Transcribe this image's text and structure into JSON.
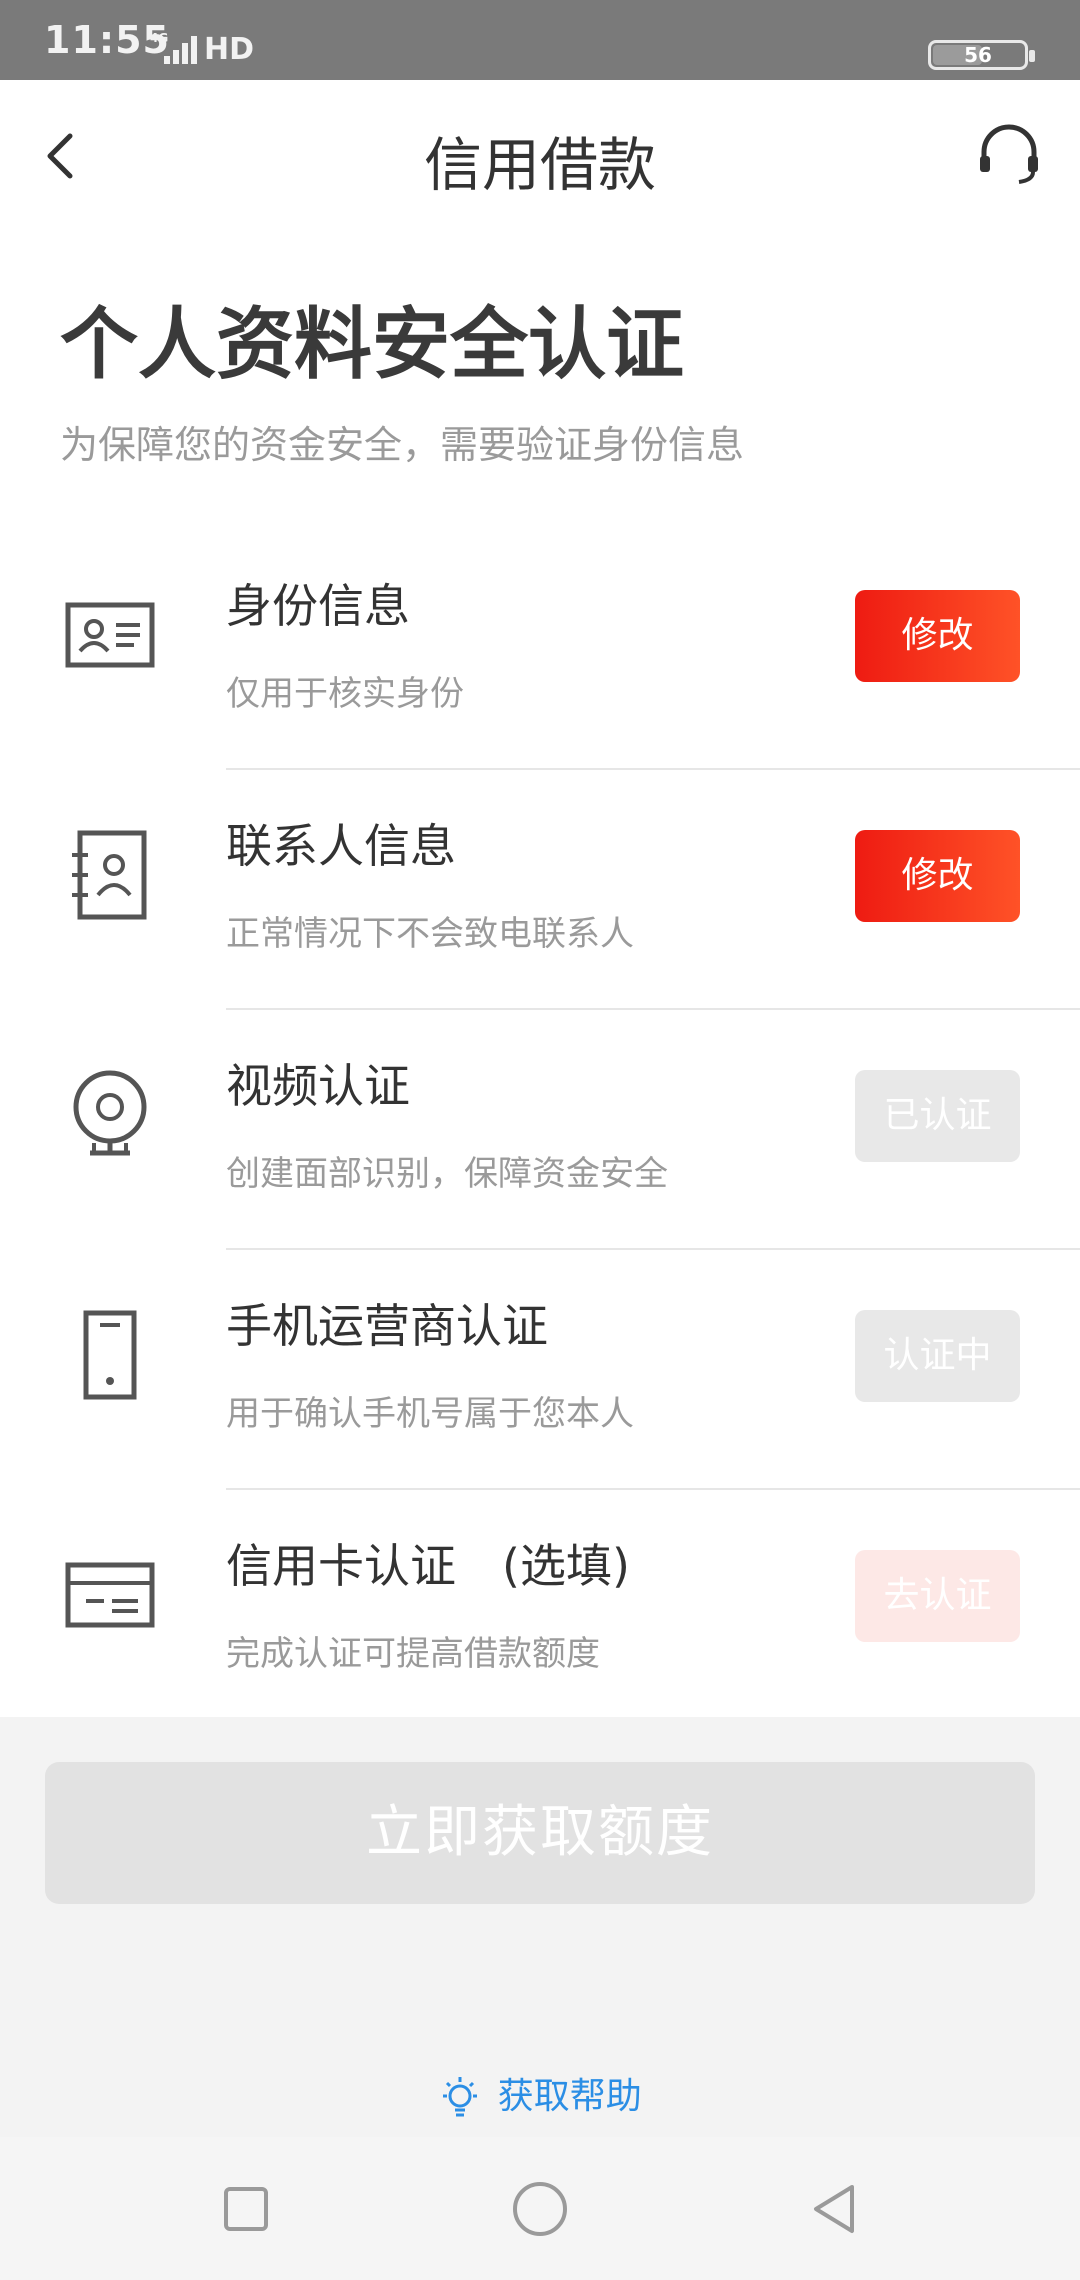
{
  "status_bar": {
    "time": "11:55",
    "network": "4G",
    "hd": "HD",
    "battery": "56"
  },
  "header": {
    "title": "信用借款",
    "back_icon": "chevron-left-icon",
    "support_icon": "headset-icon"
  },
  "page": {
    "title": "个人资料安全认证",
    "subtitle": "为保障您的资金安全，需要验证身份信息"
  },
  "items": [
    {
      "title": "身份信息",
      "desc": "仅用于核实身份",
      "button": "修改",
      "state": "active",
      "icon": "id-card-icon"
    },
    {
      "title": "联系人信息",
      "desc": "正常情况下不会致电联系人",
      "button": "修改",
      "state": "active",
      "icon": "contact-book-icon"
    },
    {
      "title": "视频认证",
      "desc": "创建面部识别，保障资金安全",
      "button": "已认证",
      "state": "done",
      "icon": "webcam-icon"
    },
    {
      "title": "手机运营商认证",
      "desc": "用于确认手机号属于您本人",
      "button": "认证中",
      "state": "pending",
      "icon": "phone-icon"
    },
    {
      "title": "信用卡认证　(选填)",
      "desc": "完成认证可提高借款额度",
      "button": "去认证",
      "state": "faded",
      "icon": "credit-card-icon"
    }
  ],
  "cta": {
    "label": "立即获取额度"
  },
  "help": {
    "label": "获取帮助",
    "icon": "lightbulb-icon"
  },
  "nav": {
    "recent_icon": "square-icon",
    "home_icon": "circle-icon",
    "back_icon": "triangle-back-icon"
  },
  "colors": {
    "accent": "#f02a17",
    "link": "#2b8ee5",
    "disabled": "#e2e2e2"
  }
}
